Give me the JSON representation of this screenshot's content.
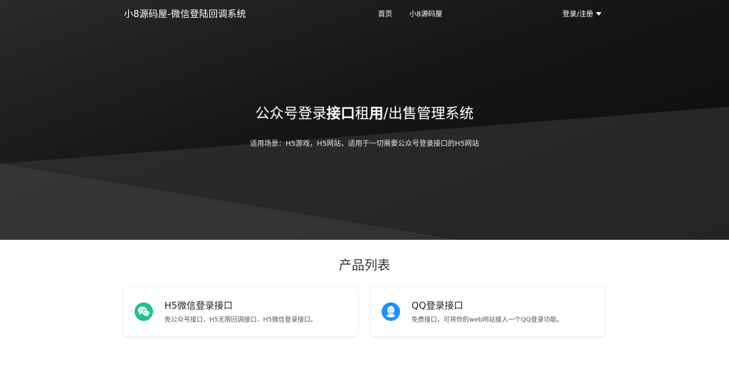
{
  "navbar": {
    "brand": "小8源码屋-微信登陆回调系统",
    "links": [
      {
        "label": "首页"
      },
      {
        "label": "小8源码屋"
      }
    ],
    "login_label": "登录/注册"
  },
  "hero": {
    "title_parts": [
      "公众号登录",
      "接口",
      "租",
      "用",
      "/出售管理系统"
    ],
    "subtitle": "适用场景：H5游戏，H5网站，适用于一切需要公众号登录接口的H5网站"
  },
  "products": {
    "section_title": "产品列表",
    "items": [
      {
        "title": "H5微信登录接口",
        "desc": "免公众号接口，H5无限回调接口，H5微信登录接口。",
        "icon": "wechat-icon",
        "color": "#1ec388"
      },
      {
        "title": "QQ登录接口",
        "desc": "免费接口，可将你的web网站接入一个QQ登录功能。",
        "icon": "qq-icon",
        "color": "#1e90ff"
      }
    ]
  },
  "colors": {
    "hero_bg": "#161617",
    "wechat_green": "#1ec388",
    "qq_blue": "#1e90ff"
  }
}
